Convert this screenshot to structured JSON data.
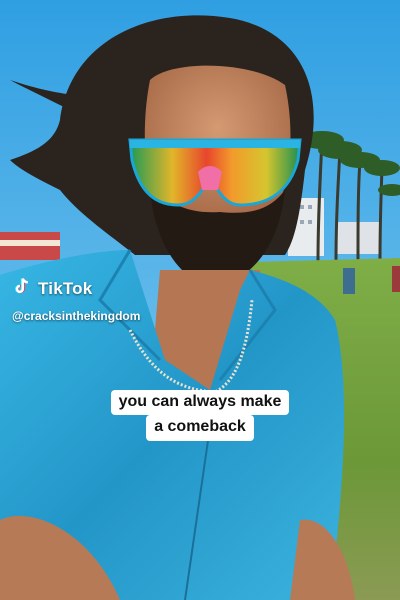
{
  "watermark": {
    "brand": "TikTok",
    "handle": "@cracksinthekingdom"
  },
  "caption": {
    "line1": "you can always make",
    "line2": "a comeback"
  },
  "icons": {
    "logo": "tiktok-logo-icon"
  },
  "colors": {
    "sky": "#38a8e6",
    "jacket": "#2aa9d9",
    "grass": "#6d9b3f",
    "caption_bg": "#ffffff",
    "caption_text": "#111111"
  }
}
